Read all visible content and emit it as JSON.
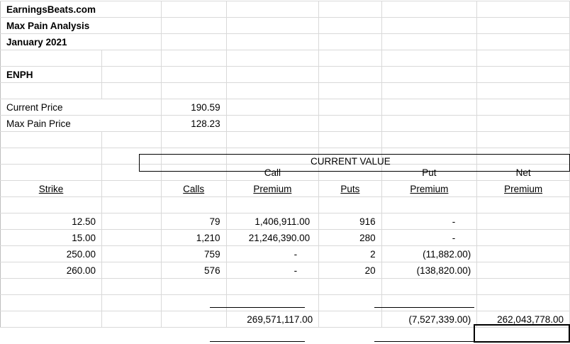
{
  "header": {
    "site": "EarningsBeats.com",
    "title": "Max Pain Analysis",
    "period": "January 2021",
    "ticker": "ENPH"
  },
  "prices": {
    "current_label": "Current Price",
    "current_value": "190.59",
    "maxpain_label": "Max Pain Price",
    "maxpain_value": "128.23"
  },
  "section_label": "CURRENT VALUE",
  "columns": {
    "strike": "Strike",
    "calls": "Calls",
    "call_premium_top": "Call",
    "call_premium_bottom": "Premium",
    "puts": "Puts",
    "put_premium_top": "Put",
    "put_premium_bottom": "Premium",
    "net_premium_top": "Net",
    "net_premium_bottom": "Premium"
  },
  "rows": [
    {
      "strike": "12.50",
      "calls": "79",
      "call_premium": "1,406,911.00",
      "puts": "916",
      "put_premium": "-"
    },
    {
      "strike": "15.00",
      "calls": "1,210",
      "call_premium": "21,246,390.00",
      "puts": "280",
      "put_premium": "-"
    },
    {
      "strike": "250.00",
      "calls": "759",
      "call_premium": "-",
      "puts": "2",
      "put_premium": "(11,882.00)"
    },
    {
      "strike": "260.00",
      "calls": "576",
      "call_premium": "-",
      "puts": "20",
      "put_premium": "(138,820.00)"
    }
  ],
  "totals": {
    "call_premium": "269,571,117.00",
    "put_premium": "(7,527,339.00)",
    "net_premium": "262,043,778.00"
  }
}
